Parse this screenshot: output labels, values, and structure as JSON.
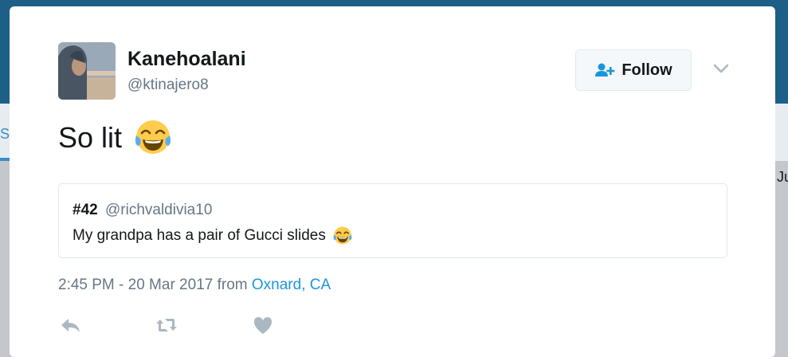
{
  "background": {
    "tab_fragment": "ST",
    "right_fragment": "Ju"
  },
  "tweet": {
    "user": {
      "display_name": "Kanehoalani",
      "handle": "@ktinajero8"
    },
    "follow_button": {
      "label": "Follow",
      "icon": "follow-user-plus-icon"
    },
    "text": "So lit",
    "emoji": "face-with-tears-of-joy",
    "quoted": {
      "display_name": "#42",
      "handle": "@richvaldivia10",
      "text": "My grandpa has a pair of Gucci slides",
      "emoji": "face-with-tears-of-joy"
    },
    "timestamp": "2:45 PM - 20 Mar 2017",
    "location_prefix": "from",
    "location": "Oxnard, CA",
    "actions": [
      "reply-icon",
      "retweet-icon",
      "like-icon"
    ]
  },
  "colors": {
    "link": "#1b95e0",
    "secondary_text": "#657786",
    "primary_text": "#14171a",
    "action_icon": "#aab8c2",
    "header": "#1d5f86"
  }
}
